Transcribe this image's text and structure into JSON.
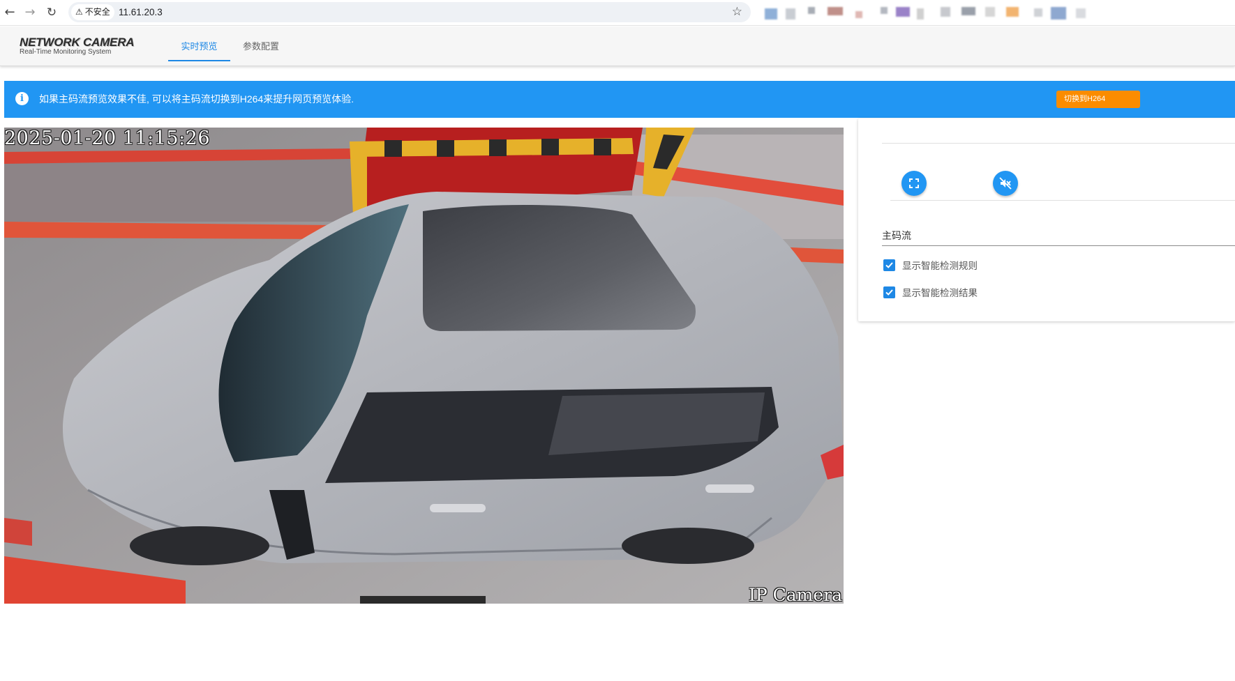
{
  "browser": {
    "back_icon": "arrow-left-icon",
    "forward_icon": "arrow-right-icon",
    "reload_icon": "reload-icon",
    "security_label": "不安全",
    "url": "11.61.20.3",
    "bookmark_icon": "star-icon"
  },
  "header": {
    "logo_title": "NETWORK CAMERA",
    "logo_subtitle": "Real-Time Monitoring System",
    "tabs": [
      {
        "label": "实时预览",
        "active": true
      },
      {
        "label": "参数配置",
        "active": false
      }
    ]
  },
  "banner": {
    "message": "如果主码流预览效果不佳, 可以将主码流切换到H264来提升网页预览体验.",
    "button_label": "切换到H264",
    "background": "#2196f3",
    "button_color": "#fb8c00"
  },
  "video": {
    "osd_timestamp": "2025-01-20  11:15:26",
    "osd_camera_name": "IP Camera"
  },
  "panel": {
    "fullscreen_icon": "fullscreen-icon",
    "mute_icon": "volume-off-icon",
    "stream_selected": "主码流",
    "options": [
      {
        "label": "显示智能检测规则",
        "checked": true
      },
      {
        "label": "显示智能检测结果",
        "checked": true
      }
    ]
  },
  "colors": {
    "accent": "#1e88e5",
    "warning": "#fb8c00"
  }
}
